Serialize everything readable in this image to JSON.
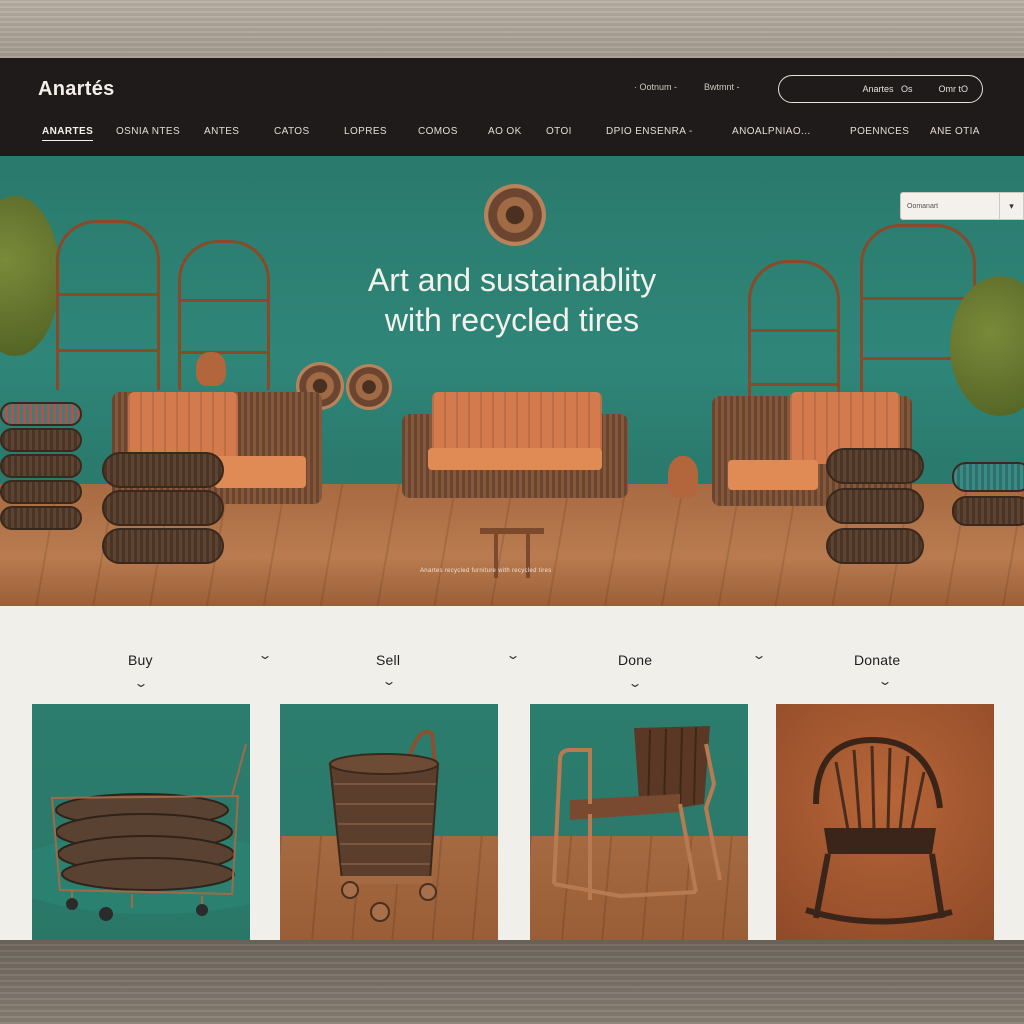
{
  "header": {
    "logo": "Anartés",
    "utility_links": [
      "Ootnum",
      "Bwtmnt"
    ],
    "account": {
      "left": "Anartes",
      "mid": "Os",
      "right": "Omr tO"
    },
    "nav": [
      {
        "label": "ANARTES",
        "active": true
      },
      {
        "label": "OSNIA NTES",
        "active": false
      },
      {
        "label": "ANTES",
        "active": false
      },
      {
        "label": "CATOS",
        "active": false
      },
      {
        "label": "LOPRES",
        "active": false
      },
      {
        "label": "COMOS",
        "active": false
      },
      {
        "label": "AO OK",
        "active": false
      },
      {
        "label": "OTOI",
        "active": false
      },
      {
        "label": "DPIO ENSENRA -",
        "active": false
      },
      {
        "label": "ANOALPNIAO...",
        "active": false
      },
      {
        "label": "POENNCES",
        "active": false
      },
      {
        "label": "ANE OTIA",
        "active": false
      }
    ]
  },
  "hero": {
    "title_line1": "Art and sustainablity",
    "title_line2": "with recycled tires",
    "caption": "Anartes recycled furniture with recycled tires",
    "dropdown": {
      "value": "Oomanart",
      "caret": "▾"
    }
  },
  "actions": [
    {
      "label": "Buy"
    },
    {
      "label": "Sell"
    },
    {
      "label": "Done"
    },
    {
      "label": "Donate"
    }
  ],
  "icons": {
    "chevron": "chevron-down-icon",
    "caret": "caret-down-icon"
  },
  "colors": {
    "header_bg": "#1f1b1a",
    "hero_teal": "#2f8678",
    "accent_rust": "#d47b4e",
    "page_bg": "#f1efea"
  }
}
